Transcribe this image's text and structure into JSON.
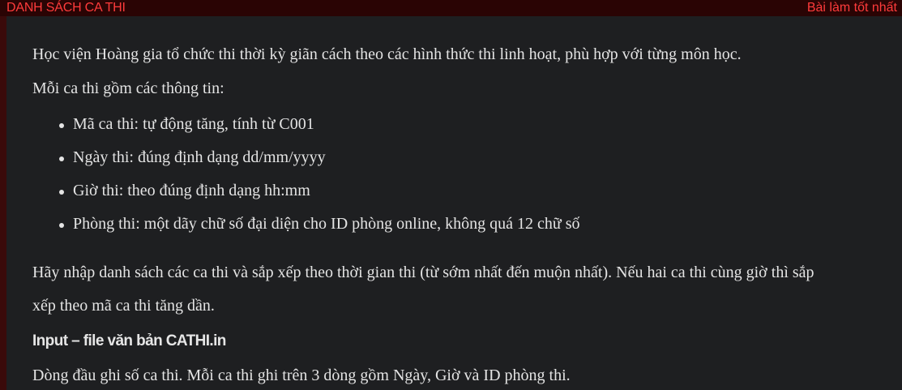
{
  "topbar": {
    "title": "DANH SÁCH CA THI",
    "best_solution_link": "Bài làm tốt nhất"
  },
  "problem": {
    "intro": "Học viện Hoàng gia tổ chức thi thời kỳ giãn cách theo các hình thức thi linh hoạt, phù hợp với từng môn học.",
    "fields_lead": "Mỗi ca thi gồm các thông tin:",
    "fields": [
      "Mã ca thi: tự động tăng, tính từ C001",
      "Ngày thi: đúng định dạng dd/mm/yyyy",
      "Giờ thi: theo đúng định dạng hh:mm",
      "Phòng thi: một dãy chữ số đại diện cho ID phòng online, không quá 12 chữ số"
    ],
    "task_line1": "Hãy nhập danh sách các ca thi và sắp xếp theo thời gian thi (từ sớm nhất đến muộn nhất). Nếu hai ca thi cùng giờ thì sắp",
    "task_line2": "xếp theo mã ca thi tăng dần.",
    "input_heading": "Input – file văn bản CATHI.in",
    "input_desc": "Dòng đầu ghi số ca thi. Mỗi ca thi ghi trên 3 dòng gồm Ngày, Giờ và ID phòng thi."
  }
}
